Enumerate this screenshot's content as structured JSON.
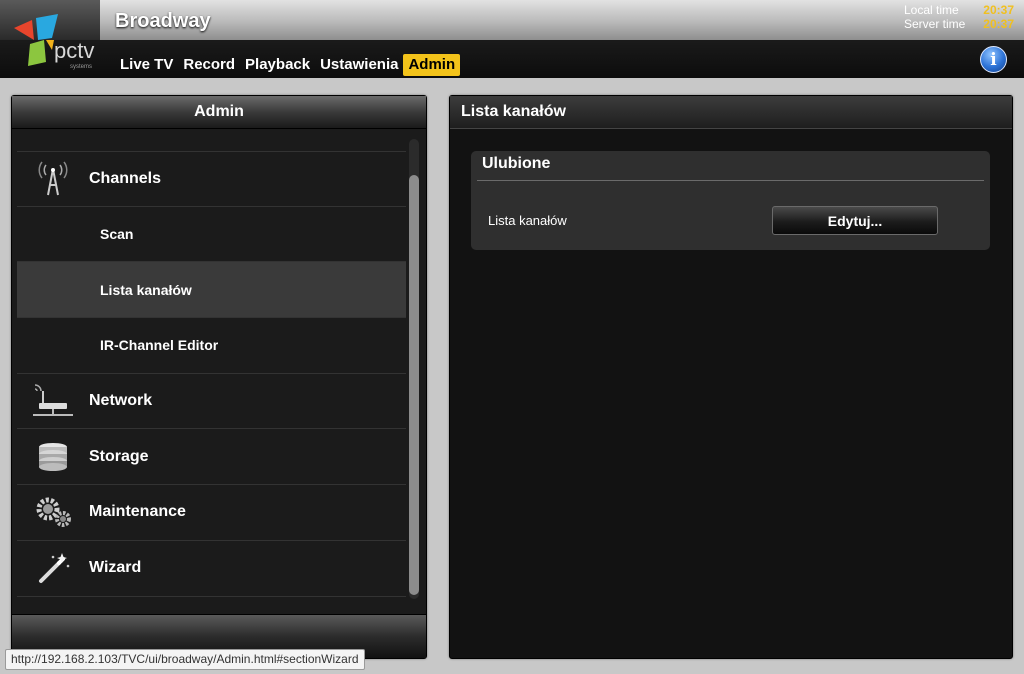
{
  "header": {
    "app_title": "Broadway",
    "logo_text": "pctv",
    "logo_subtext": "systems",
    "time": {
      "local_label": "Local time",
      "local_value": "20:37",
      "server_label": "Server time",
      "server_value": "20:37"
    },
    "nav": [
      {
        "label": "Live TV"
      },
      {
        "label": "Record"
      },
      {
        "label": "Playback"
      },
      {
        "label": "Ustawienia"
      },
      {
        "label": "Admin",
        "active": true
      }
    ],
    "info_icon": "info-icon",
    "accent_color": "#f3c31a"
  },
  "left_panel": {
    "title": "Admin",
    "items": [
      {
        "label": "Channels",
        "icon": "antenna-icon",
        "type": "category"
      },
      {
        "label": "Scan",
        "type": "sub"
      },
      {
        "label": "Lista kanałów",
        "type": "sub",
        "selected": true
      },
      {
        "label": "IR-Channel Editor",
        "type": "sub"
      },
      {
        "label": "Network",
        "icon": "network-icon",
        "type": "category"
      },
      {
        "label": "Storage",
        "icon": "storage-icon",
        "type": "category"
      },
      {
        "label": "Maintenance",
        "icon": "gears-icon",
        "type": "category"
      },
      {
        "label": "Wizard",
        "icon": "wand-icon",
        "type": "category"
      }
    ]
  },
  "right_panel": {
    "title": "Lista kanałów",
    "favorites": {
      "title": "Ulubione",
      "row_label": "Lista kanałów",
      "button_label": "Edytuj..."
    }
  },
  "status_bar": {
    "url": "http://192.168.2.103/TVC/ui/broadway/Admin.html#sectionWizard"
  }
}
